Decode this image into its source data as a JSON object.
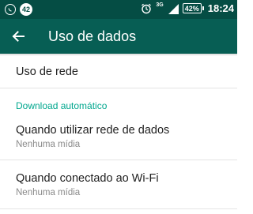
{
  "status_bar": {
    "notification_count": "42",
    "network_type": "3G",
    "battery": "42%",
    "time": "18:24"
  },
  "app_bar": {
    "title": "Uso de dados"
  },
  "settings": {
    "network_usage": {
      "label": "Uso de rede"
    },
    "section_header": "Download automático",
    "mobile_data": {
      "label": "Quando utilizar rede de dados",
      "value": "Nenhuma mídia"
    },
    "wifi": {
      "label": "Quando conectado ao Wi-Fi",
      "value": "Nenhuma mídia"
    }
  },
  "colors": {
    "status_bar": "#054d44",
    "app_bar": "#075e54",
    "accent": "#00a78e"
  }
}
